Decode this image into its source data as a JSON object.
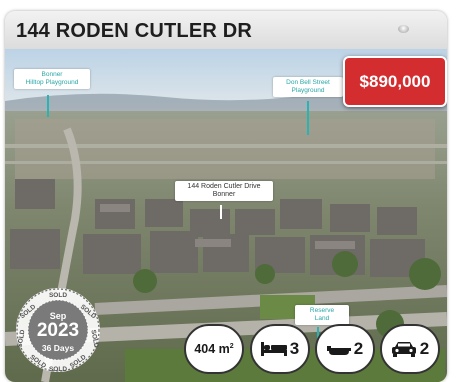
{
  "listing": {
    "address": "144 RODEN CUTLER DR",
    "price": "$890,000"
  },
  "map_labels": {
    "bonner": {
      "line1": "Bonner",
      "line2": "Hilltop Playground"
    },
    "don_bell": {
      "line1": "Don Bell Street",
      "line2": "Playground"
    },
    "subject": {
      "line1": "144 Roden Cutler Drive",
      "line2": "Bonner"
    },
    "reserve": {
      "line1": "Reserve",
      "line2": "Land"
    }
  },
  "sold_stamp": {
    "ring_text": "SOLD",
    "month": "Sep",
    "year": "2023",
    "days": "36 Days"
  },
  "features": {
    "land_area": "404 m",
    "land_area_unit_sup": "2",
    "bedrooms": "3",
    "bathrooms": "2",
    "car_spaces": "2"
  },
  "icons": [
    "dot-icon",
    "bed-icon",
    "bath-icon",
    "car-icon"
  ],
  "colors": {
    "price_bg": "#d42d2f",
    "label_text": "#2aa7a7",
    "pill_border": "#333333"
  }
}
